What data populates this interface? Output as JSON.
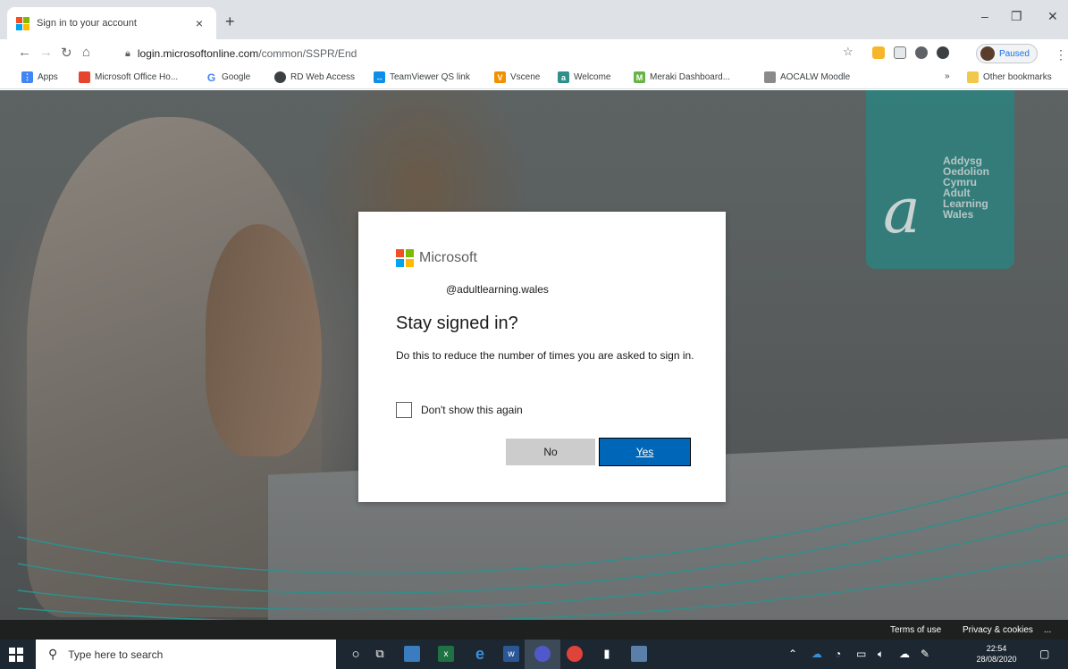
{
  "browser": {
    "tab_title": "Sign in to your account",
    "tab_close": "×",
    "new_tab": "+",
    "window_minimize": "–",
    "window_restore": "❐",
    "window_close": "✕",
    "url_host": "login.microsoftonline.com",
    "url_path": "/common/SSPR/End",
    "profile_label": "Paused"
  },
  "bookmarks": [
    {
      "label": "Apps",
      "icon": "apps-grid-icon",
      "color": "#4285f4"
    },
    {
      "label": "Microsoft Office Ho...",
      "icon": "office-icon",
      "color": "#e8432d"
    },
    {
      "label": "Google",
      "icon": "google-icon",
      "color": "#4285f4"
    },
    {
      "label": "RD Web Access",
      "icon": "rd-web-icon",
      "color": "#3c4043"
    },
    {
      "label": "TeamViewer QS link",
      "icon": "teamviewer-icon",
      "color": "#0e8ee9"
    },
    {
      "label": "Vscene",
      "icon": "vscene-icon",
      "color": "#f29100"
    },
    {
      "label": "Welcome",
      "icon": "welcome-icon",
      "color": "#2f8f8b"
    },
    {
      "label": "Meraki Dashboard...",
      "icon": "meraki-icon",
      "color": "#67b346"
    },
    {
      "label": "AOCALW Moodle",
      "icon": "moodle-icon",
      "color": "#8a8a8a"
    },
    {
      "label": "»",
      "icon": "overflow-icon",
      "color": "#5f6368"
    },
    {
      "label": "Other bookmarks",
      "icon": "folder-icon",
      "color": "#f2c84b"
    }
  ],
  "brand": {
    "lines": [
      "Addysg",
      "Oedolion",
      "Cymru",
      "Adult",
      "Learning",
      "Wales"
    ],
    "color": "#2f7f7d"
  },
  "dialog": {
    "logo_text": "Microsoft",
    "account": "@adultlearning.wales",
    "heading": "Stay signed in?",
    "description": "Do this to reduce the number of times you are asked to sign in.",
    "checkbox_label": "Don't show this again",
    "no_label": "No",
    "yes_label": "Yes",
    "accent": "#0067b8"
  },
  "footer": {
    "terms": "Terms of use",
    "privacy": "Privacy & cookies",
    "more": "..."
  },
  "taskbar": {
    "search_placeholder": "Type here to search",
    "time": "22:54",
    "date": "28/08/2020"
  }
}
